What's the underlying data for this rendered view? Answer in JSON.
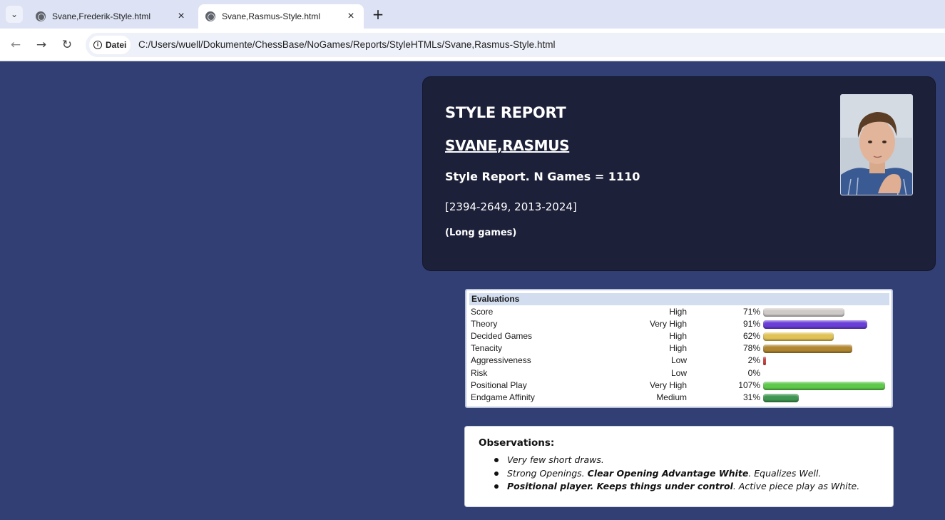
{
  "browser": {
    "tabs": [
      {
        "title": "Svane,Frederik-Style.html",
        "active": false
      },
      {
        "title": "Svane,Rasmus-Style.html",
        "active": true
      }
    ],
    "chip_label": "Datei",
    "url": "C:/Users/wuell/Dokumente/ChessBase/NoGames/Reports/StyleHTMLs/Svane,Rasmus-Style.html"
  },
  "header": {
    "title": "STYLE REPORT",
    "player_last": "SVANE",
    "player_sep": ",",
    "player_first": "RASMUS",
    "subtitle": "Style Report. N Games = 1110",
    "range": "[2394-2649, 2013-2024]",
    "game_type": "(Long games)"
  },
  "evaluations": {
    "heading": "Evaluations",
    "rows": [
      {
        "label": "Score",
        "level": "High",
        "pct": "71%",
        "value": 71,
        "color": "#cfcac8"
      },
      {
        "label": "Theory",
        "level": "Very High",
        "pct": "91%",
        "value": 91,
        "color": "#6a3fd8"
      },
      {
        "label": "Decided Games",
        "level": "High",
        "pct": "62%",
        "value": 62,
        "color": "#e0c255"
      },
      {
        "label": "Tenacity",
        "level": "High",
        "pct": "78%",
        "value": 78,
        "color": "#b08630"
      },
      {
        "label": "Aggressiveness",
        "level": "Low",
        "pct": "2%",
        "value": 2,
        "color": "#d03a3a"
      },
      {
        "label": "Risk",
        "level": "Low",
        "pct": "0%",
        "value": 0,
        "color": "#888888"
      },
      {
        "label": "Positional Play",
        "level": "Very High",
        "pct": "107%",
        "value": 107,
        "color": "#5ec94a"
      },
      {
        "label": "Endgame Affinity",
        "level": "Medium",
        "pct": "31%",
        "value": 31,
        "color": "#3e9650"
      }
    ]
  },
  "observations": {
    "title": "Observations:",
    "items": [
      {
        "parts": [
          {
            "text": "Very few short draws.",
            "bold": false
          }
        ]
      },
      {
        "parts": [
          {
            "text": "Strong Openings. ",
            "bold": false
          },
          {
            "text": "Clear Opening Advantage White",
            "bold": true
          },
          {
            "text": ". Equalizes Well.",
            "bold": false
          }
        ]
      },
      {
        "parts": [
          {
            "text": "Positional player. Keeps things under control",
            "bold": true
          },
          {
            "text": ". Active piece play as White.",
            "bold": false
          }
        ]
      }
    ]
  }
}
